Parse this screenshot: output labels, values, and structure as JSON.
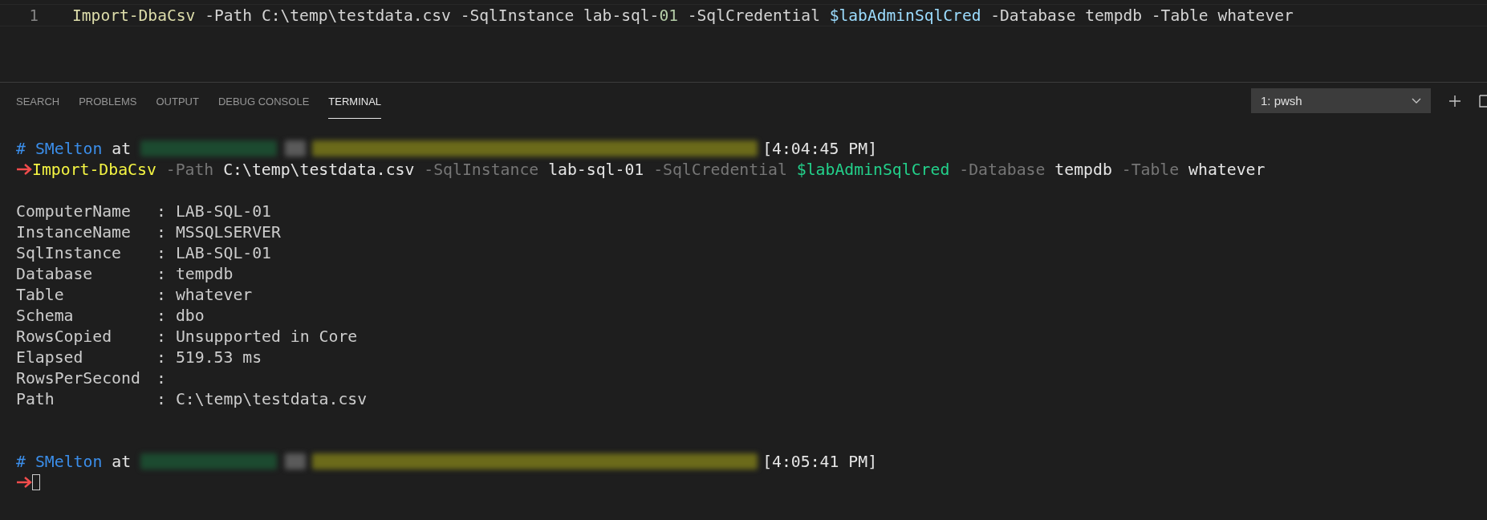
{
  "editor": {
    "lines": [
      {
        "number": "1",
        "tokens": [
          {
            "kind": "function",
            "text": "Import-DbaCsv"
          },
          {
            "kind": "plain",
            "text": " -Path C:\\temp\\testdata.csv -SqlInstance lab-sql-"
          },
          {
            "kind": "number",
            "text": "01"
          },
          {
            "kind": "plain",
            "text": " -SqlCredential "
          },
          {
            "kind": "variable",
            "text": "$labAdminSqlCred"
          },
          {
            "kind": "plain",
            "text": " -Database tempdb -Table whatever"
          }
        ]
      }
    ]
  },
  "panel": {
    "tabs": [
      {
        "label": "SEARCH",
        "selected": false
      },
      {
        "label": "PROBLEMS",
        "selected": false
      },
      {
        "label": "OUTPUT",
        "selected": false
      },
      {
        "label": "DEBUG CONSOLE",
        "selected": false
      },
      {
        "label": "TERMINAL",
        "selected": true
      }
    ],
    "terminal_select": {
      "value": "1: pwsh"
    }
  },
  "terminal": {
    "blocks": [
      {
        "prompt": {
          "hash": "#",
          "user": "SMelton",
          "at": "at",
          "time": "[4:04:45 PM]"
        },
        "command": [
          {
            "kind": "command",
            "text": "Import-DbaCsv"
          },
          {
            "kind": "parameter",
            "text": " -Path "
          },
          {
            "kind": "argument",
            "text": "C:\\temp\\testdata.csv"
          },
          {
            "kind": "parameter",
            "text": " -SqlInstance "
          },
          {
            "kind": "argument",
            "text": "lab-sql-01"
          },
          {
            "kind": "parameter",
            "text": " -SqlCredential "
          },
          {
            "kind": "variable",
            "text": "$labAdminSqlCred"
          },
          {
            "kind": "parameter",
            "text": " -Database "
          },
          {
            "kind": "argument",
            "text": "tempdb"
          },
          {
            "kind": "parameter",
            "text": " -Table "
          },
          {
            "kind": "argument",
            "text": "whatever"
          }
        ],
        "output": [
          {
            "name": "ComputerName",
            "separator": ":",
            "value": "LAB-SQL-01"
          },
          {
            "name": "InstanceName",
            "separator": ":",
            "value": "MSSQLSERVER"
          },
          {
            "name": "SqlInstance",
            "separator": ":",
            "value": "LAB-SQL-01"
          },
          {
            "name": "Database",
            "separator": ":",
            "value": "tempdb"
          },
          {
            "name": "Table",
            "separator": ":",
            "value": "whatever"
          },
          {
            "name": "Schema",
            "separator": ":",
            "value": "dbo"
          },
          {
            "name": "RowsCopied",
            "separator": ":",
            "value": "Unsupported in Core"
          },
          {
            "name": "Elapsed",
            "separator": ":",
            "value": "519.53 ms"
          },
          {
            "name": "RowsPerSecond",
            "separator": ":"
          },
          {
            "name": "Path",
            "separator": ":",
            "value": "C:\\temp\\testdata.csv"
          }
        ]
      },
      {
        "prompt": {
          "hash": "#",
          "user": "SMelton",
          "at": "at",
          "time": "[4:05:41 PM]"
        }
      }
    ]
  }
}
